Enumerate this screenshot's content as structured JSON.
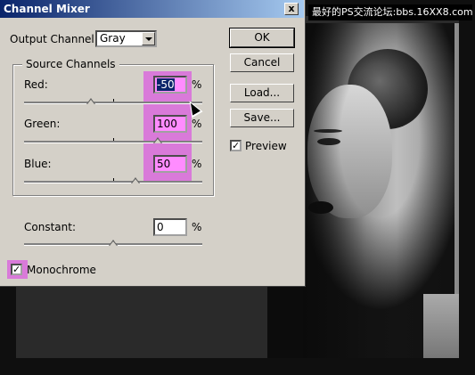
{
  "banner": "最好的PS交流论坛:bbs.16XX8.com",
  "dialog": {
    "title": "Channel Mixer",
    "close_glyph": "x",
    "output_channel_label": "Output Channel:",
    "output_channel_value": "Gray",
    "source_channels_label": "Source Channels",
    "channels": [
      {
        "label": "Red:",
        "value": "-50",
        "unit": "%",
        "slider_percent": -50
      },
      {
        "label": "Green:",
        "value": "100",
        "unit": "%",
        "slider_percent": 100
      },
      {
        "label": "Blue:",
        "value": "50",
        "unit": "%",
        "slider_percent": 50
      }
    ],
    "constant": {
      "label": "Constant:",
      "value": "0",
      "unit": "%",
      "slider_percent": 0
    },
    "monochrome_label": "Monochrome",
    "monochrome_checked": true,
    "buttons": {
      "ok": "OK",
      "cancel": "Cancel",
      "load": "Load...",
      "save": "Save..."
    },
    "preview_label": "Preview",
    "preview_checked": true
  },
  "colors": {
    "highlight": "#d97ad9",
    "title_bar": "#0a246a",
    "dialog_bg": "#d4d0c8"
  }
}
